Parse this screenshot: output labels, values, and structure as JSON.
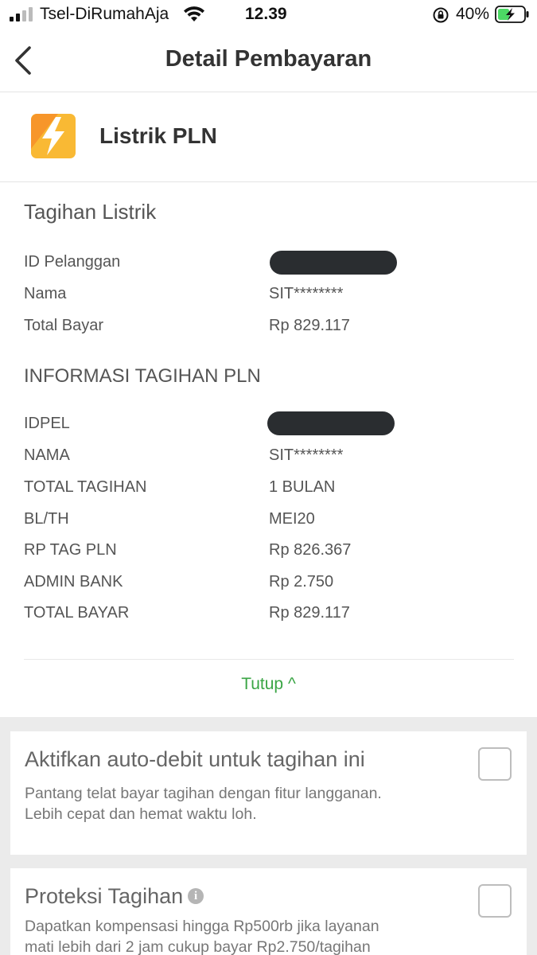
{
  "status_bar": {
    "carrier": "Tsel-DiRumahAja",
    "time": "12.39",
    "battery_percent": "40%",
    "battery_level": 0.4
  },
  "nav": {
    "title": "Detail Pembayaran",
    "back_icon": "chevron-left-icon"
  },
  "product": {
    "name": "Listrik PLN",
    "icon": "lightning-icon",
    "icon_color": "#F7B731"
  },
  "tagihan_listrik": {
    "title": "Tagihan Listrik",
    "rows": [
      {
        "label": "ID Pelanggan",
        "value": ""
      },
      {
        "label": "Nama",
        "value": "SIT********"
      },
      {
        "label": "Total Bayar",
        "value": "Rp 829.117"
      }
    ]
  },
  "informasi": {
    "title": "INFORMASI TAGIHAN PLN",
    "rows": [
      {
        "label": "IDPEL",
        "value": ""
      },
      {
        "label": "NAMA",
        "value": "SIT********"
      },
      {
        "label": "TOTAL TAGIHAN",
        "value": "1 BULAN"
      },
      {
        "label": "BL/TH",
        "value": "MEI20"
      },
      {
        "label": "RP TAG PLN",
        "value": "Rp 826.367"
      },
      {
        "label": "ADMIN BANK",
        "value": "Rp 2.750"
      },
      {
        "label": "TOTAL BAYAR",
        "value": "Rp 829.117"
      }
    ]
  },
  "collapse": {
    "label": "Tutup ^",
    "color": "#3AA545"
  },
  "auto_debit": {
    "title": "Aktifkan auto-debit untuk tagihan ini",
    "desc_line1": "Pantang telat bayar tagihan dengan fitur langganan.",
    "desc_line2": "Lebih cepat dan hemat waktu loh.",
    "checked": false
  },
  "proteksi": {
    "title": "Proteksi Tagihan",
    "desc_line1": "Dapatkan kompensasi hingga Rp500rb jika layanan",
    "desc_line2": "mati lebih dari 2 jam cukup bayar Rp2.750/tagihan",
    "checked": false
  }
}
